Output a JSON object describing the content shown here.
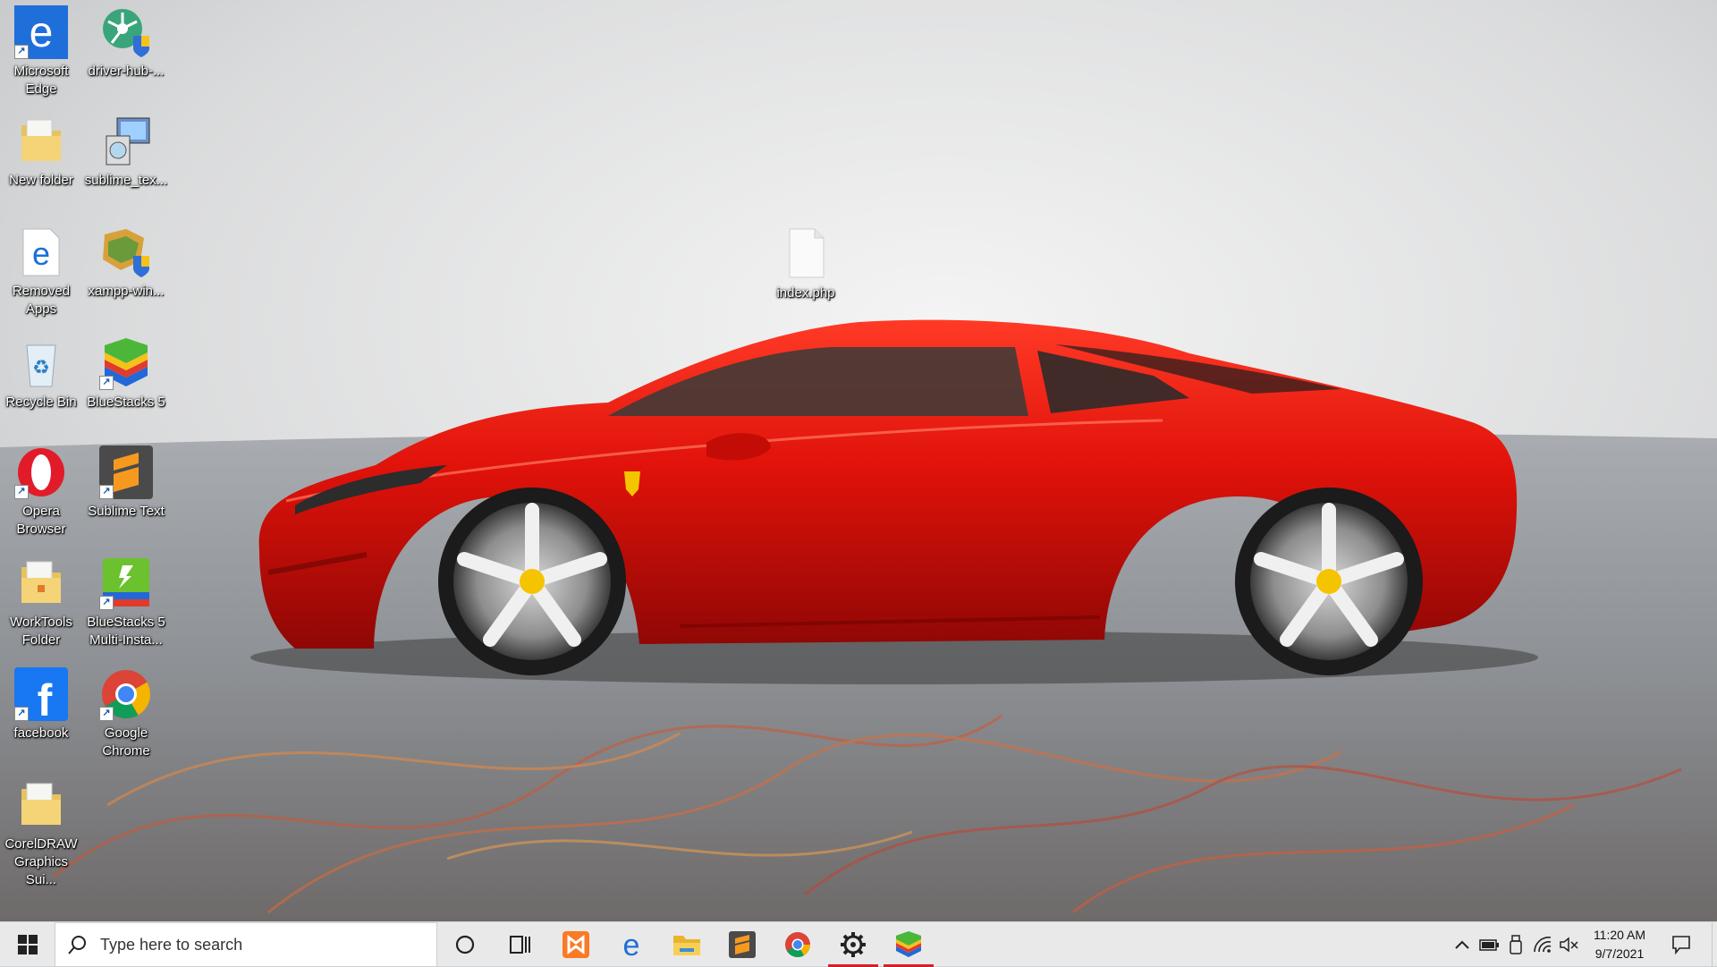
{
  "desktop": {
    "icons": [
      {
        "label": "Microsoft Edge",
        "icon": "edge-icon"
      },
      {
        "label": "driver-hub-...",
        "icon": "driver-hub-installer-icon"
      },
      {
        "label": "New folder",
        "icon": "folder-icon"
      },
      {
        "label": "sublime_tex...",
        "icon": "installer-icon"
      },
      {
        "label": "Removed Apps",
        "icon": "edge-document-icon"
      },
      {
        "label": "xampp-win...",
        "icon": "xampp-installer-icon"
      },
      {
        "label": "Recycle Bin",
        "icon": "recycle-bin-icon"
      },
      {
        "label": "BlueStacks 5",
        "icon": "bluestacks-icon"
      },
      {
        "label": "Opera Browser",
        "icon": "opera-icon"
      },
      {
        "label": "Sublime Text",
        "icon": "sublime-text-icon"
      },
      {
        "label": "WorkTools Folder",
        "icon": "folder-icon"
      },
      {
        "label": "BlueStacks 5 Multi-Insta...",
        "icon": "bluestacks-multi-instance-icon"
      },
      {
        "label": "facebook",
        "icon": "facebook-icon"
      },
      {
        "label": "Google Chrome",
        "icon": "chrome-icon"
      },
      {
        "label": "CorelDRAW Graphics Sui...",
        "icon": "folder-icon"
      },
      {
        "label": "index.php",
        "icon": "blank-file-icon"
      }
    ]
  },
  "taskbar": {
    "search_placeholder": "Type here to search",
    "pinned": [
      {
        "name": "cortana",
        "icon": "cortana-circle-icon"
      },
      {
        "name": "task-view",
        "icon": "task-view-icon"
      },
      {
        "name": "xampp",
        "icon": "xampp-icon"
      },
      {
        "name": "edge",
        "icon": "edge-icon"
      },
      {
        "name": "file-explorer",
        "icon": "folder-icon"
      },
      {
        "name": "sublime-text",
        "icon": "sublime-text-icon"
      },
      {
        "name": "chrome",
        "icon": "chrome-icon"
      },
      {
        "name": "settings",
        "icon": "gear-icon",
        "active": true
      },
      {
        "name": "bluestacks",
        "icon": "bluestacks-icon",
        "active": true
      }
    ],
    "tray": {
      "icons": [
        "chevron-up-icon",
        "battery-icon",
        "usb-icon",
        "wifi-icon",
        "speaker-muted-icon"
      ],
      "time": "11:20 AM",
      "date": "9/7/2021"
    },
    "accent_color": "#d1202a"
  }
}
